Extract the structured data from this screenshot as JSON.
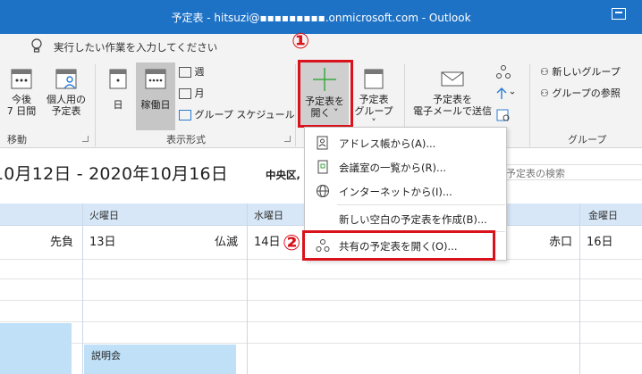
{
  "window": {
    "title": "予定表 - hitsuzi@▪▪▪▪▪▪▪▪▪.onmicrosoft.com  -  Outlook"
  },
  "tell_me": {
    "placeholder": "実行したい作業を入力してください"
  },
  "ribbon": {
    "buttons": {
      "today": {
        "line1": "今後",
        "line2": "7 日間"
      },
      "personal": {
        "line1": "個人用の",
        "line2": "予定表"
      },
      "day": "日",
      "workweek": "稼働日",
      "week": "週",
      "month": "月",
      "group_schedule": "グループ スケジュール",
      "open_calendar": {
        "line1": "予定表を",
        "line2": "開く"
      },
      "calendar_group": {
        "line1": "予定表",
        "line2": "グループ"
      },
      "email_calendar": {
        "line1": "予定表を",
        "line2": "電子メールで送信"
      },
      "new_group": "新しいグループ",
      "browse_groups": "グループの参照"
    },
    "groups": {
      "move": "移動",
      "arrangement": "表示形式",
      "group": "グループ"
    }
  },
  "calendar": {
    "range": "10月12日 - 2020年10月16日",
    "location": "中央区,",
    "search_placeholder": "予定表の検索",
    "days": [
      {
        "name": "火曜日",
        "date": "13日",
        "rokuyo": "仏滅"
      },
      {
        "name": "水曜日",
        "date": "14日",
        "rokuyo": ""
      },
      {
        "name": "金曜日",
        "date": "16日",
        "rokuyo": ""
      }
    ],
    "left_rokuyo": "先負",
    "thu_rokuyo": "赤口",
    "event": "説明会"
  },
  "menu": {
    "items": [
      "アドレス帳から(A)...",
      "会議室の一覧から(R)...",
      "インターネットから(I)...",
      "新しい空白の予定表を作成(B)...",
      "共有の予定表を開く(O)..."
    ]
  },
  "annotations": {
    "step1": "①",
    "step2": "②"
  },
  "colors": {
    "titlebar": "#1e72c6",
    "highlight": "#d9121b",
    "dayhead": "#d7e7f7",
    "event": "#bfe0f7"
  }
}
